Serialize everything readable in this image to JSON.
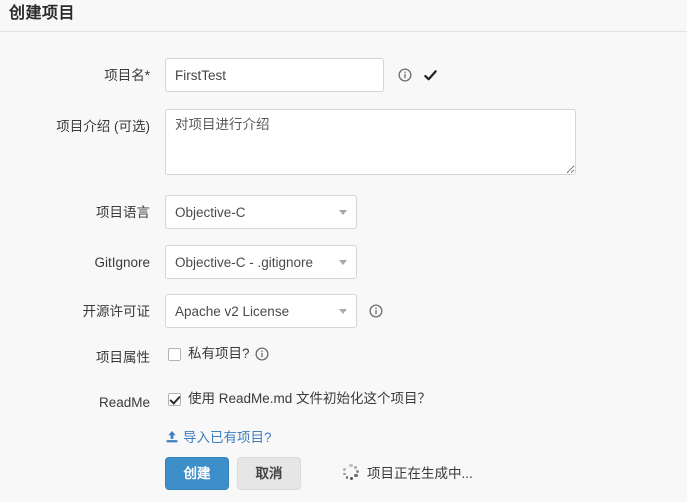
{
  "header": {
    "title": "创建项目"
  },
  "form": {
    "project_name": {
      "label": "项目名*",
      "value": "FirstTest",
      "placeholder": "",
      "info_icon": "info-circle-icon",
      "valid_icon": "check-icon"
    },
    "description": {
      "label": "项目介绍 (可选)",
      "value": "",
      "placeholder": "对项目进行介绍"
    },
    "language": {
      "label": "项目语言",
      "selected": "Objective-C",
      "caret_icon": "chevron-down-icon"
    },
    "gitignore": {
      "label": "GitIgnore",
      "selected": "Objective-C - .gitignore",
      "caret_icon": "chevron-down-icon"
    },
    "license": {
      "label": "开源许可证",
      "selected": "Apache v2 License",
      "caret_icon": "chevron-down-icon",
      "info_icon": "info-circle-icon"
    },
    "visibility": {
      "label": "项目属性",
      "checkbox_label": "私有项目?",
      "checked": false,
      "info_icon": "info-circle-icon"
    },
    "readme": {
      "label": "ReadMe",
      "checkbox_label": "使用 ReadMe.md 文件初始化这个项目？",
      "checked": true
    },
    "import_link": {
      "label": "导入已有项目?",
      "icon": "upload-icon"
    }
  },
  "actions": {
    "submit_label": "创建",
    "cancel_label": "取消",
    "status_text": "项目正在生成中...",
    "spinner_icon": "loading-spinner-icon"
  },
  "colors": {
    "page_background": "#f8f8f8",
    "primary_button": "#3d8fc9",
    "cancel_button": "#e6e6e6",
    "link": "#3f7fbe",
    "divider": "#e2e2e2",
    "input_border": "#d6d6d6"
  }
}
